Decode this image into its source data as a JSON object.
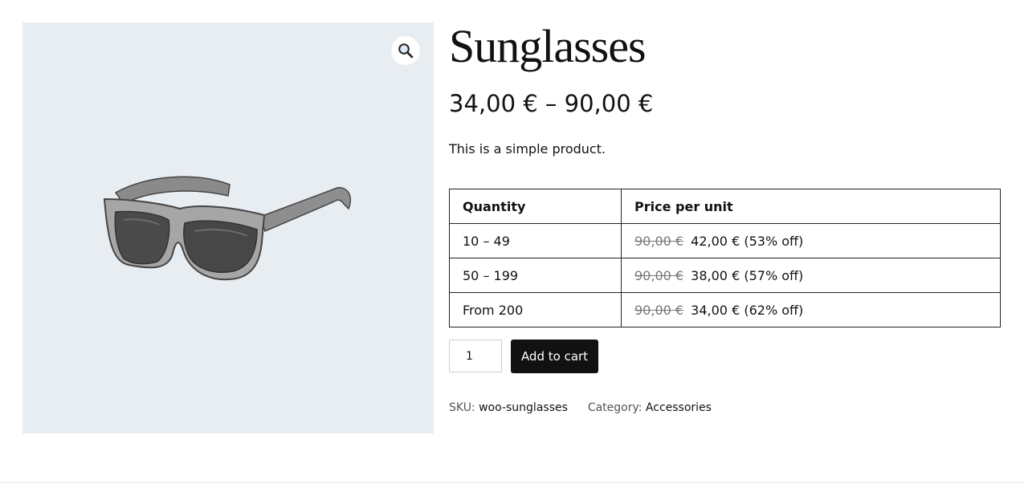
{
  "product": {
    "title": "Sunglasses",
    "price_range": "34,00 € – 90,00 €",
    "description": "This is a simple product."
  },
  "gallery": {
    "zoom_icon": "magnifier-icon",
    "image_subject": "sunglasses-illustration"
  },
  "tier_table": {
    "headers": [
      "Quantity",
      "Price per unit"
    ],
    "rows": [
      {
        "quantity": "10 – 49",
        "original": "90,00 €",
        "price": "42,00 €",
        "discount": "(53% off)"
      },
      {
        "quantity": "50 – 199",
        "original": "90,00 €",
        "price": "38,00 €",
        "discount": "(57% off)"
      },
      {
        "quantity": "From 200",
        "original": "90,00 €",
        "price": "34,00 €",
        "discount": "(62% off)"
      }
    ]
  },
  "cart": {
    "quantity_value": "1",
    "add_label": "Add to cart"
  },
  "meta": {
    "sku_label": "SKU:",
    "sku_value": "woo-sunglasses",
    "category_label": "Category:",
    "category_value": "Accessories"
  },
  "colors": {
    "gallery_bg": "#e8edf2",
    "button_bg": "#111111",
    "text": "#111111"
  }
}
